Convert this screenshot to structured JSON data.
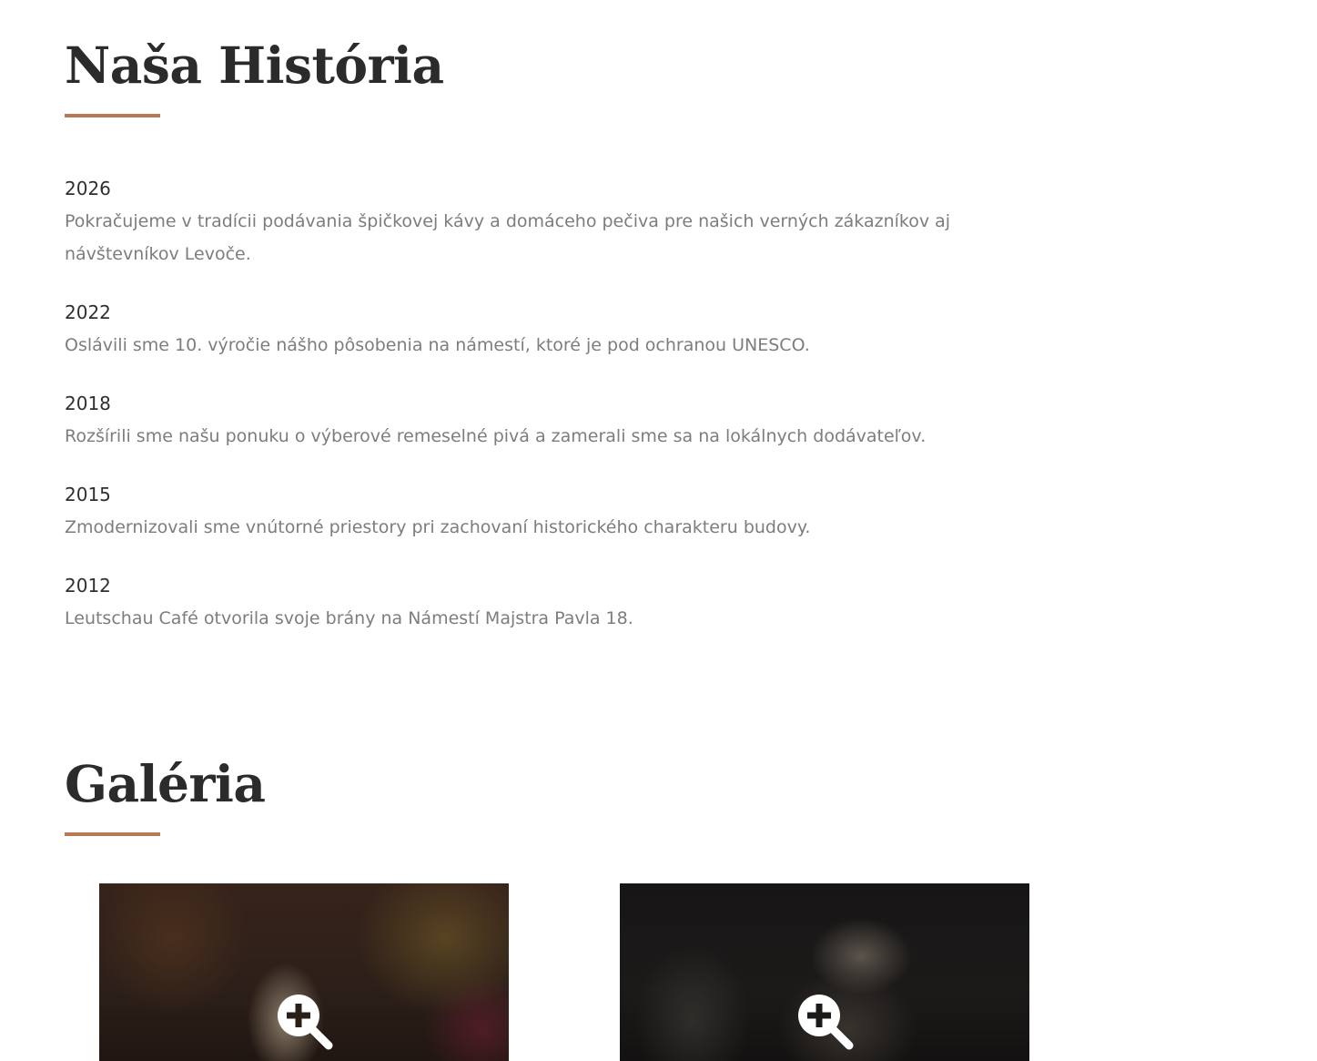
{
  "history": {
    "title": "Naša História",
    "entries": [
      {
        "year": "2026",
        "text": "Pokračujeme v tradícii podávania špičkovej kávy a domáceho pečiva pre našich verných zákazníkov aj návštevníkov Levoče."
      },
      {
        "year": "2022",
        "text": "Oslávili sme 10. výročie nášho pôsobenia na námestí, ktoré je pod ochranou UNESCO."
      },
      {
        "year": "2018",
        "text": "Rozšírili sme našu ponuku o výberové remeselné pivá a zamerali sme sa na lokálnych dodávateľov."
      },
      {
        "year": "2015",
        "text": "Zmodernizovali sme vnútorné priestory pri zachovaní historického charakteru budovy."
      },
      {
        "year": "2012",
        "text": "Leutschau Café otvorila svoje brány na Námestí Majstra Pavla 18."
      }
    ]
  },
  "gallery": {
    "title": "Galéria",
    "items": [
      {
        "icon": "zoom-in-icon"
      },
      {
        "icon": "zoom-in-icon"
      }
    ]
  },
  "colors": {
    "accent": "#b57a55",
    "heading": "#2b2b2b",
    "year": "#2f2f2f",
    "body_text": "#7d7d7d",
    "background": "#ffffff"
  }
}
